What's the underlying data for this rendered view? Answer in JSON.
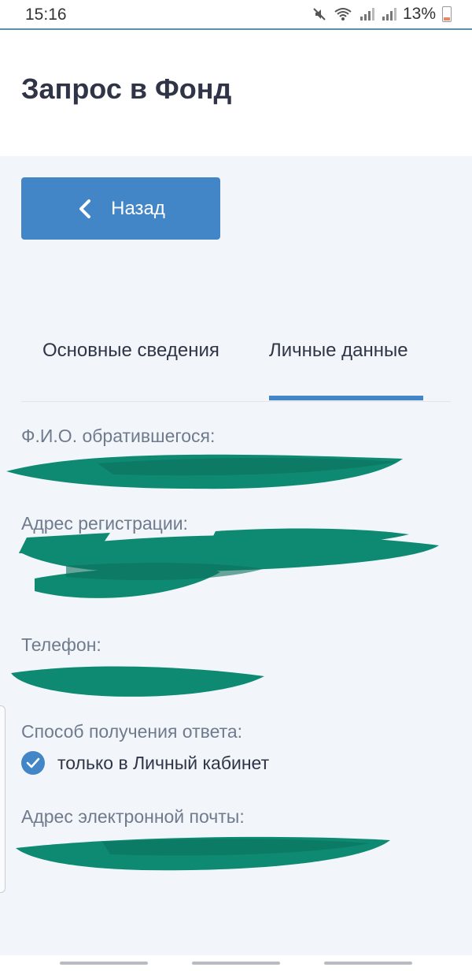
{
  "status_bar": {
    "time": "15:16",
    "battery": "13%"
  },
  "header": {
    "title": "Запрос в Фонд"
  },
  "back_button": {
    "label": "Назад"
  },
  "tabs": [
    {
      "label": "Основные сведения",
      "active": false
    },
    {
      "label": "Личные данные",
      "active": true
    }
  ],
  "fields": {
    "name": {
      "label": "Ф.И.О. обратившегося:",
      "value": ""
    },
    "address": {
      "label": "Адрес регистрации:",
      "value": ""
    },
    "phone": {
      "label": "Телефон:",
      "value": ""
    },
    "response_method": {
      "label": "Способ получения ответа:",
      "option": "только в Личный кабинет",
      "checked": true
    },
    "email": {
      "label": "Адрес электронной почты:",
      "value": ""
    }
  },
  "colors": {
    "accent": "#4286c8",
    "redaction": "#0f8a72",
    "background": "#f2f6fb"
  }
}
